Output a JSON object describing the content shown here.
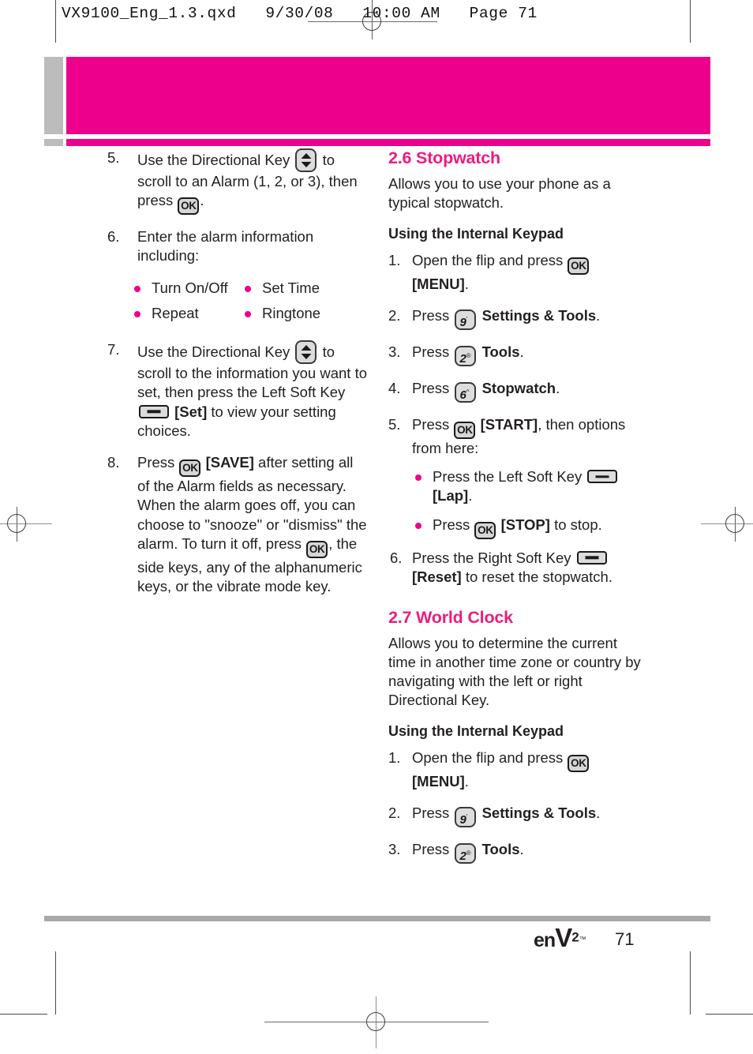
{
  "document": {
    "header_line": "VX9100_Eng_1.3.qxd   9/30/08   10:00 AM   Page 71",
    "page_number": "71",
    "logo": {
      "en": "en",
      "v": "V",
      "superscript": "2",
      "tm": "™"
    },
    "colors": {
      "accent_magenta": "#ec008c",
      "heading_pink": "#ec1c7d",
      "tab_gray": "#bcbcbc",
      "rule_gray": "#a8a8a8",
      "text": "#231f20"
    }
  },
  "left_column": {
    "steps": [
      {
        "num": "5.",
        "parts": [
          {
            "t": "text",
            "v": "Use the Directional Key "
          },
          {
            "t": "key",
            "icon": "directional-key"
          },
          {
            "t": "text",
            "v": " to scroll to an Alarm (1, 2, or 3), then press "
          },
          {
            "t": "key",
            "icon": "ok-key"
          },
          {
            "t": "text",
            "v": "."
          }
        ],
        "plain": "Use the Directional Key  to scroll to an Alarm (1, 2, or 3), then press OK."
      },
      {
        "num": "6.",
        "plain": "Enter the alarm information including:",
        "sub_bullets_columns": [
          [
            "Turn On/Off",
            "Repeat"
          ],
          [
            "Set Time",
            "Ringtone"
          ]
        ]
      },
      {
        "num": "7.",
        "plain": "Use the Directional Key  to scroll to the information you want to set, then press the Left Soft Key  [Set] to view your setting choices."
      },
      {
        "num": "8.",
        "plain": "Press OK [SAVE] after setting all of the Alarm fields as necessary. When the alarm goes off, you can choose to \"snooze\" or \"dismiss\" the alarm. To turn it off, press OK , the side keys, any of the alphanumeric keys, or the vibrate mode key."
      }
    ],
    "fragments": {
      "s5_a": "Use the Directional Key",
      "s5_b": "to",
      "s5_c": "scroll to an Alarm (1, 2, or 3), then",
      "s5_d": "press",
      "s5_e": ".",
      "s6_a": "Enter the alarm information including:",
      "s6_b1": "Turn On/Off",
      "s6_b2": "Repeat",
      "s6_b3": "Set Time",
      "s6_b4": "Ringtone",
      "s7_a": "Use the Directional Key",
      "s7_b": "to",
      "s7_c": "scroll to the information you want to set, then press the Left Soft Key",
      "s7_d": "[Set]",
      "s7_e": "to view your setting choices.",
      "s8_a": "Press",
      "s8_b": "[SAVE]",
      "s8_c": "after setting all of the Alarm fields as necessary. When the alarm goes off, you can choose to \"snooze\" or \"dismiss\" the alarm. To turn it off, press",
      "s8_d": ", the side keys, any of the alphanumeric keys, or the vibrate mode key."
    }
  },
  "right_column": {
    "section_26": {
      "heading": "2.6 Stopwatch",
      "intro": "Allows you to use your phone as a typical stopwatch.",
      "subheading": "Using the Internal Keypad",
      "steps": [
        {
          "num": "1.",
          "a": "Open the flip and press",
          "b": "[MENU]",
          "c": ".",
          "key": "ok-key"
        },
        {
          "num": "2.",
          "a": "Press",
          "key_digit": "9",
          "key_sup": "′",
          "b": "Settings & Tools",
          "c": "."
        },
        {
          "num": "3.",
          "a": "Press",
          "key_digit": "2",
          "key_sup": "®",
          "b": "Tools",
          "c": "."
        },
        {
          "num": "4.",
          "a": "Press",
          "key_digit": "6",
          "key_sup": "^",
          "b": "Stopwatch",
          "c": "."
        },
        {
          "num": "5.",
          "a": "Press",
          "key": "ok-key",
          "b": "[START]",
          "c": ", then options from here:"
        }
      ],
      "step5_bullets": [
        {
          "a": "Press the Left Soft Key",
          "key": "soft-key",
          "b": "[Lap]",
          "c": "."
        },
        {
          "a": "Press",
          "key": "ok-key",
          "b": "[STOP]",
          "c": "to stop."
        }
      ],
      "step6": {
        "num": "6.",
        "a": "Press the Right Soft Key",
        "key": "soft-key",
        "b": "[Reset]",
        "c": "to reset the stopwatch."
      }
    },
    "section_27": {
      "heading": "2.7 World Clock",
      "intro": "Allows you to determine the current time in another time zone or country by navigating with the left or right Directional Key.",
      "subheading": "Using the Internal Keypad",
      "steps": [
        {
          "num": "1.",
          "a": "Open the flip and press",
          "b": "[MENU]",
          "c": ".",
          "key": "ok-key"
        },
        {
          "num": "2.",
          "a": "Press",
          "key_digit": "9",
          "key_sup": "′",
          "b": "Settings & Tools",
          "c": "."
        },
        {
          "num": "3.",
          "a": "Press",
          "key_digit": "2",
          "key_sup": "®",
          "b": "Tools",
          "c": "."
        }
      ]
    }
  },
  "keys": {
    "ok_label": "OK"
  }
}
